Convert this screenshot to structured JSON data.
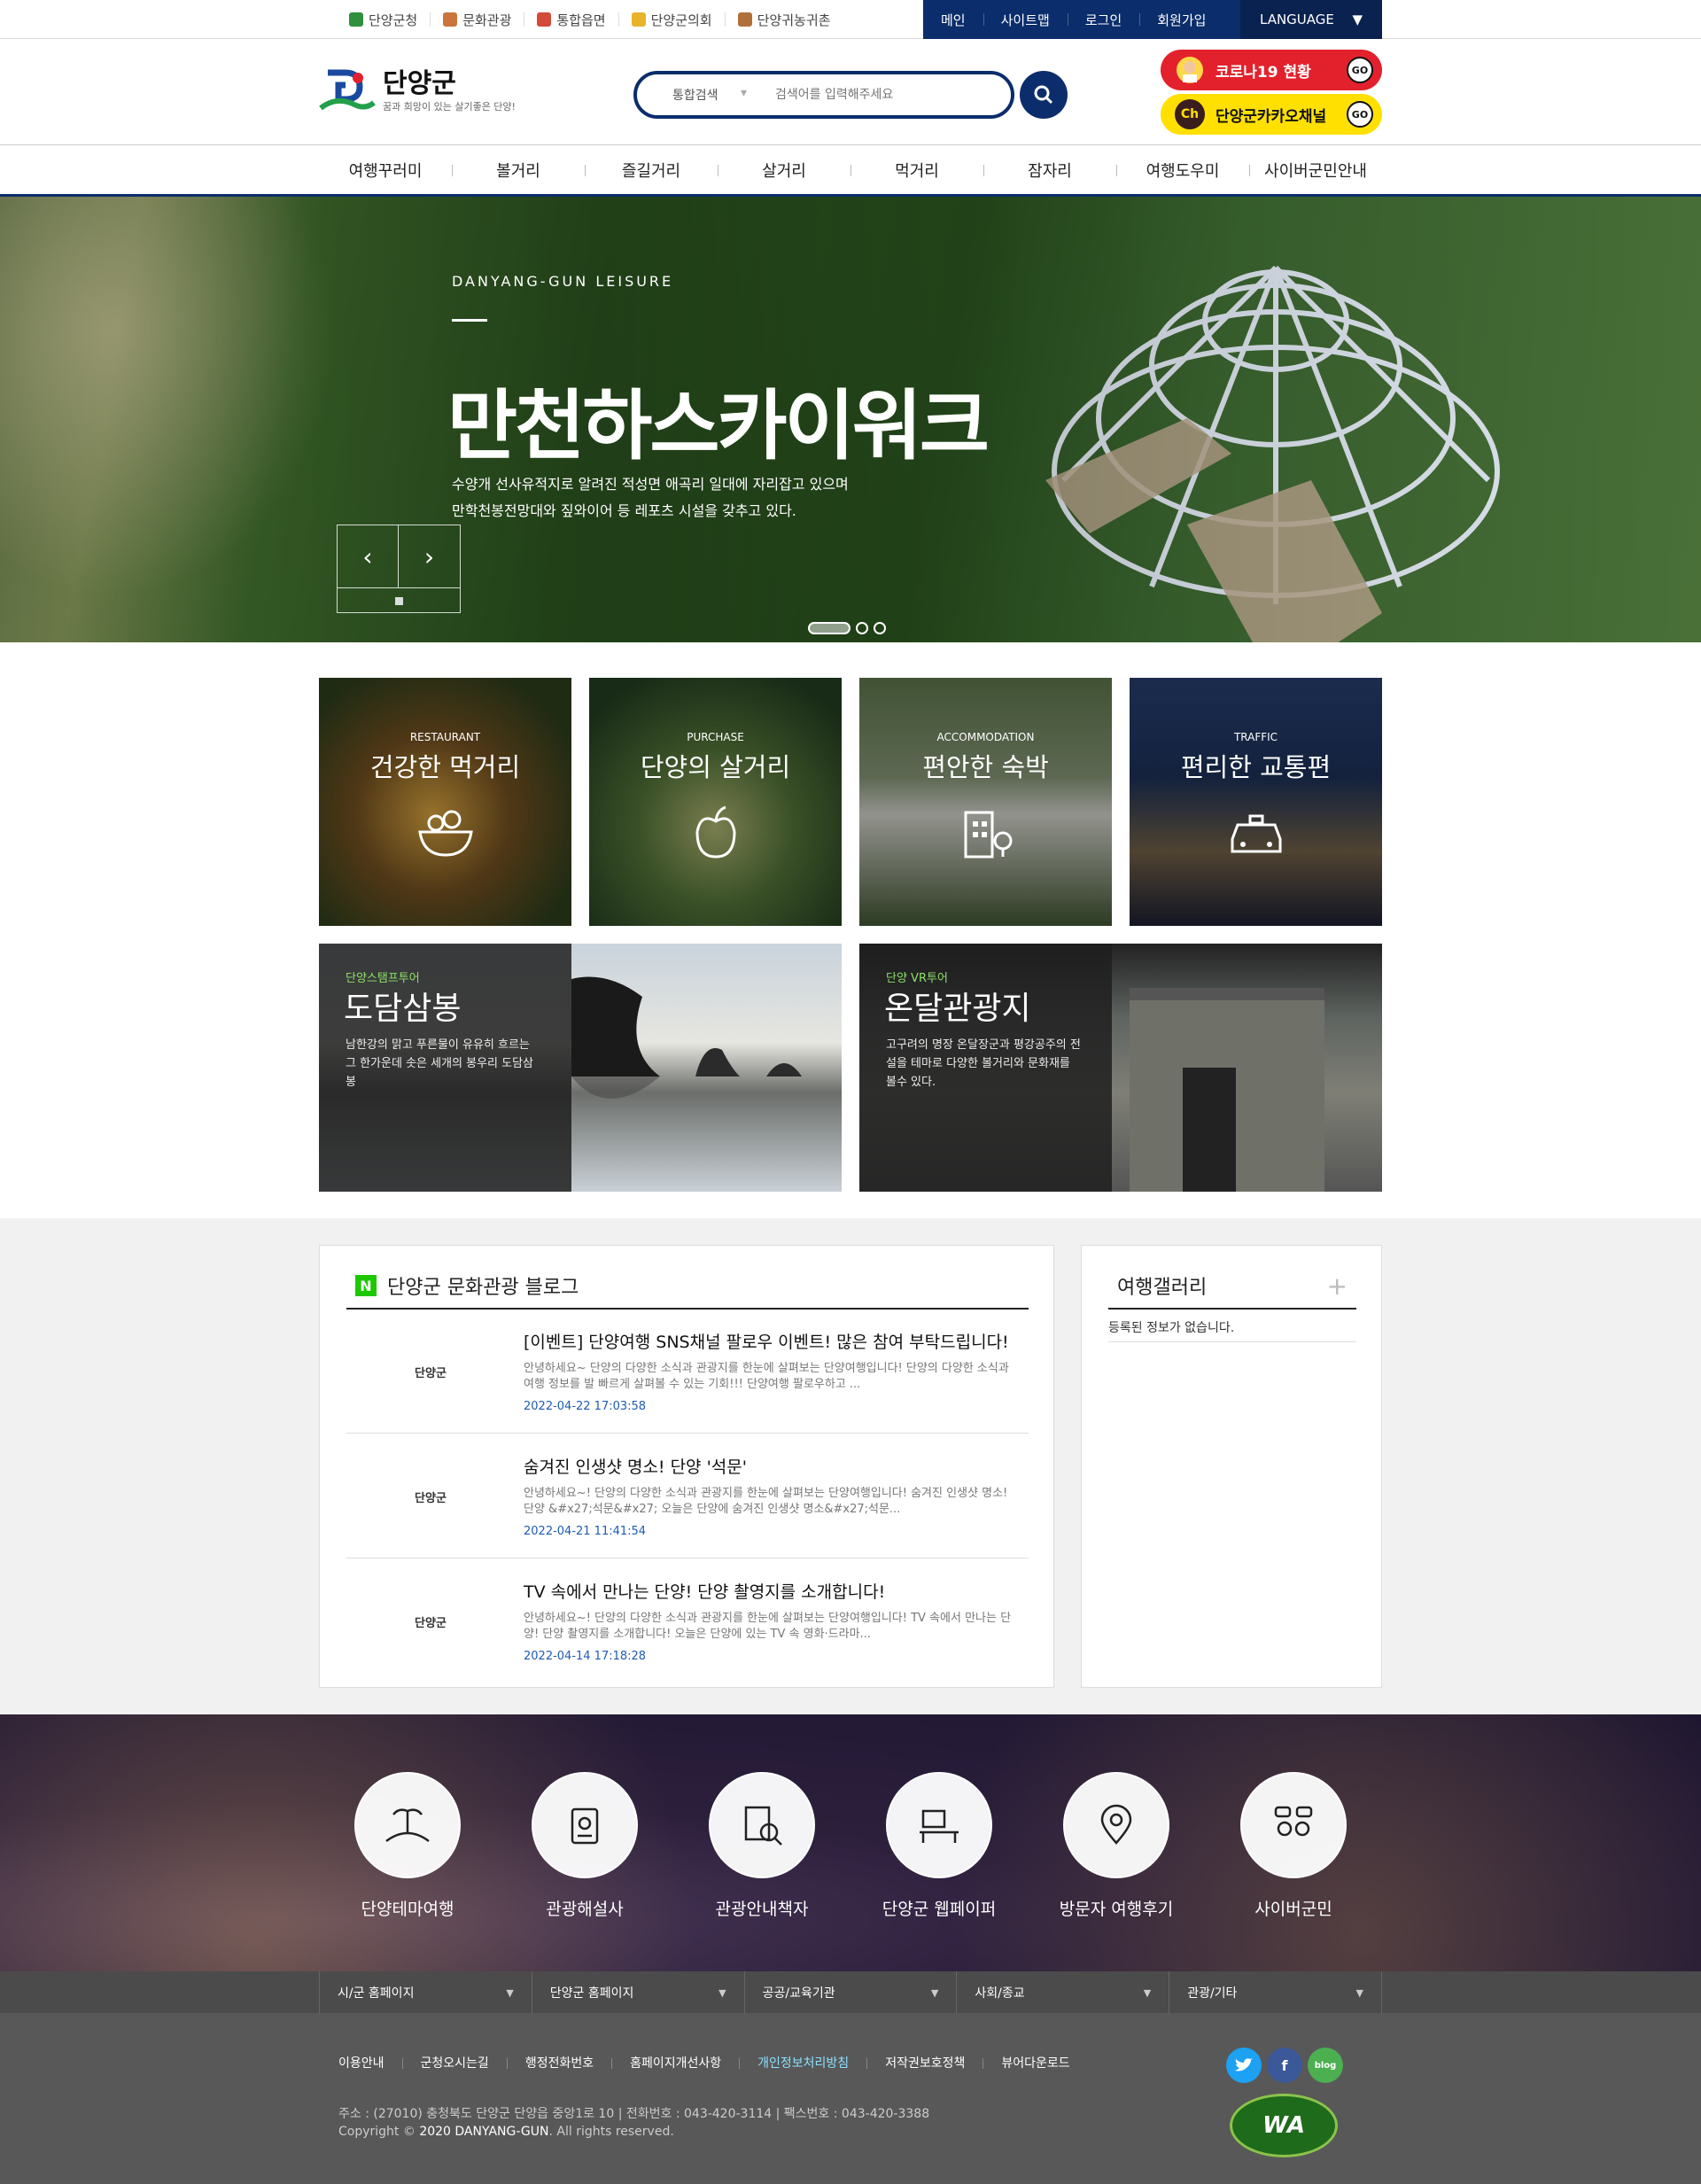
{
  "topbar": {
    "links": [
      "단양군청",
      "문화관광",
      "통합읍면",
      "단양군의회",
      "단양귀농귀촌"
    ],
    "nav": [
      "메인",
      "사이트맵",
      "로그인",
      "회원가입"
    ],
    "language": "LANGUAGE"
  },
  "header": {
    "logo_title": "단양군",
    "logo_sub": "꿈과 희망이 있는 살기좋은 단양!",
    "search_category": "통합검색",
    "search_placeholder": "검색어를 입력해주세요",
    "covid_label": "코로나19 현황",
    "kakao_label": "단양군카카오채널",
    "go": "GO"
  },
  "gnb": [
    "여행꾸러미",
    "볼거리",
    "즐길거리",
    "살거리",
    "먹거리",
    "잠자리",
    "여행도우미",
    "사이버군민안내"
  ],
  "hero": {
    "subtitle": "DANYANG-GUN  LEISURE",
    "title": "만천하스카이워크",
    "desc_line1": "수양개 선사유적지로 알려진 적성면 애곡리 일대에 자리잡고 있으며",
    "desc_line2": "만학천봉전망대와 짚와이어 등 레포츠 시설을 갖추고 있다."
  },
  "cards": [
    {
      "eng": "RESTAURANT",
      "kor": "건강한 먹거리"
    },
    {
      "eng": "PURCHASE",
      "kor": "단양의 살거리"
    },
    {
      "eng": "ACCOMMODATION",
      "kor": "편안한 숙박"
    },
    {
      "eng": "TRAFFIC",
      "kor": "편리한 교통편"
    }
  ],
  "features": [
    {
      "tag": "단양스탬프투어",
      "title": "도담삼봉",
      "desc": "남한강의 맑고 푸른물이 유유히 흐르는 그 한가운데 솟은 세개의 봉우리 도담삼봉"
    },
    {
      "tag": "단양 VR투어",
      "title": "온달관광지",
      "desc": "고구려의 명장 온달장군과 평강공주의 전설을 테마로 다양한 볼거리와 문화재를 볼수 있다."
    }
  ],
  "blog": {
    "title": "단양군 문화관광 블로그",
    "thumb_label": "단양군",
    "posts": [
      {
        "title": "[이벤트] 단양여행 SNS채널 팔로우 이벤트! 많은 참여 부탁드립니다!",
        "desc": "안녕하세요~ 단양의 다양한 소식과 관광지를 한눈에 살펴보는 단양여행입니다! 단양의 다양한 소식과 여행 정보를 발 빠르게 살펴볼 수 있는 기회!!! 단양여행 팔로우하고 ...",
        "date": "2022-04-22 17:03:58"
      },
      {
        "title": "숨겨진 인생샷 명소! 단양 '석문'",
        "desc": "안녕하세요~! 단양의 다양한 소식과 관광지를 한눈에 살펴보는 단양여행입니다! 숨겨진 인생샷 명소! 단양 &#x27;석문&#x27; 오늘은 단양에 숨겨진 인생샷 명소&#x27;석문...",
        "date": "2022-04-21 11:41:54"
      },
      {
        "title": "TV 속에서 만나는 단양! 단양 촬영지를 소개합니다!",
        "desc": "안녕하세요~! 단양의 다양한 소식과 관광지를 한눈에 살펴보는 단양여행입니다! TV 속에서 만나는 단양! 단양 촬영지를 소개합니다! 오늘은 단양에 있는 TV 속 영화·드라마...",
        "date": "2022-04-14 17:18:28"
      }
    ]
  },
  "gallery": {
    "title": "여행갤러리",
    "plus": "+",
    "empty": "등록된 정보가 없습니다."
  },
  "quick": [
    "단양테마여행",
    "관광해설사",
    "관광안내책자",
    "단양군 웹페이퍼",
    "방문자 여행후기",
    "사이버군민"
  ],
  "family": [
    "시/군 홈페이지",
    "단양군 홈페이지",
    "공공/교육기관",
    "사회/종교",
    "관광/기타"
  ],
  "footer": {
    "links": [
      "이용안내",
      "군청오시는길",
      "행정전화번호",
      "홈페이지개선사항",
      "개인정보처리방침",
      "저작권보호정책",
      "뷰어다운로드"
    ],
    "address": "주소 : (27010) 충청북도 단양군 단양읍 중앙1로 10 | 전화번호 : 043-420-3114 | 팩스번호 : 043-420-3388",
    "copy_pre": "Copyright © ",
    "copy_brand": "2020 DANYANG-GUN",
    "copy_post": ". All rights reserved.",
    "wa": "WA",
    "social": {
      "facebook": "f",
      "blog": "blog"
    }
  },
  "colors": {
    "navy": "#0b2d6b",
    "covid": "#e3212c",
    "kakao": "#ffe000",
    "naver": "#1ec800",
    "date": "#1f5bb5"
  }
}
